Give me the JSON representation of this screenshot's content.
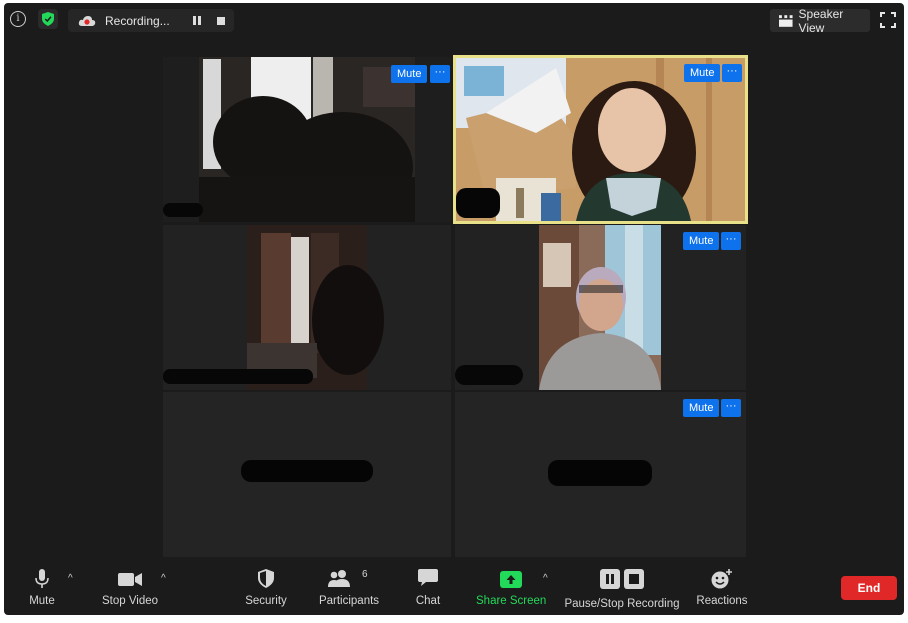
{
  "topbar": {
    "recording_label": "Recording...",
    "speaker_view_label": "Speaker View"
  },
  "tiles": {
    "mute_label": "Mute",
    "more_label": "···"
  },
  "toolbar": {
    "mute": "Mute",
    "stop_video": "Stop Video",
    "security": "Security",
    "participants": "Participants",
    "participants_count": "6",
    "chat": "Chat",
    "share_screen": "Share Screen",
    "pause_stop_recording": "Pause/Stop Recording",
    "reactions": "Reactions",
    "end": "End"
  },
  "colors": {
    "window_bg": "#1b1b1b",
    "active_speaker_border": "#e8e18a",
    "mute_button": "#0e72ed",
    "share_screen_green": "#23d959",
    "end_button": "#e02828"
  }
}
